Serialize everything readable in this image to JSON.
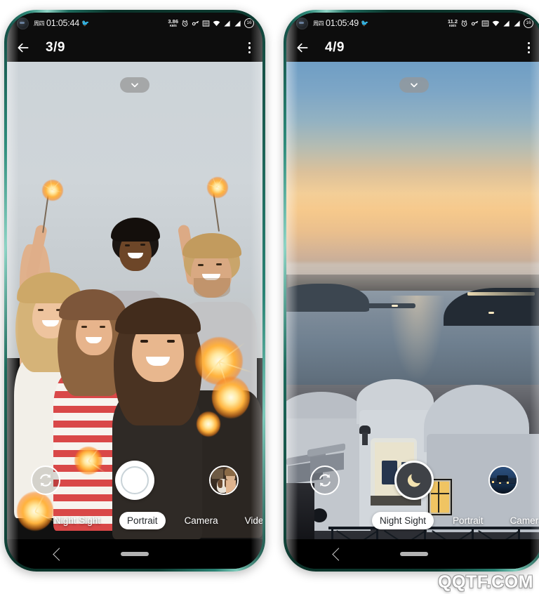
{
  "watermark": "QQTF.COM",
  "phones": [
    {
      "id": "phone-left",
      "status": {
        "day": "周四",
        "time": "01:05:44",
        "net_speed_value": "3.86",
        "net_speed_unit": "KB/S",
        "battery": "16",
        "icons": [
          "camera-punchhole",
          "bird-icon",
          "alarm-icon",
          "vpn-key-icon",
          "volte-icon",
          "wifi-icon",
          "signal-icon",
          "signal-icon",
          "battery-icon"
        ]
      },
      "appbar": {
        "back_icon": "arrow-back-icon",
        "page_count": "3/9",
        "menu_icon": "kebab-menu-icon"
      },
      "viewfinder": {
        "collapse_icon": "chevron-down-icon",
        "scene": "group-selfie-sparklers",
        "flip_icon": "camera-flip-icon",
        "shutter_icon": "shutter-button",
        "shutter_style": "normal",
        "thumbnail": "woman-with-dog-thumbnail"
      },
      "modes": [
        {
          "label": "Night Sight",
          "selected": false
        },
        {
          "label": "Portrait",
          "selected": true
        },
        {
          "label": "Camera",
          "selected": false
        },
        {
          "label": "Video",
          "selected": false
        }
      ],
      "navbar": {
        "back_icon": "nav-back-icon",
        "home_icon": "nav-home-indicator"
      }
    },
    {
      "id": "phone-right",
      "status": {
        "day": "周四",
        "time": "01:05:49",
        "net_speed_value": "11.2",
        "net_speed_unit": "KB/S",
        "battery": "16",
        "icons": [
          "camera-punchhole",
          "bird-icon",
          "alarm-icon",
          "vpn-key-icon",
          "volte-icon",
          "wifi-icon",
          "signal-icon",
          "signal-icon",
          "battery-icon"
        ]
      },
      "appbar": {
        "back_icon": "arrow-back-icon",
        "page_count": "4/9",
        "menu_icon": "kebab-menu-icon"
      },
      "viewfinder": {
        "collapse_icon": "chevron-down-icon",
        "scene": "santorini-sunset-seascape",
        "flip_icon": "camera-flip-icon",
        "shutter_icon": "moon-icon",
        "shutter_style": "night",
        "thumbnail": "night-cityscape-thumbnail"
      },
      "modes": [
        {
          "label": "Night Sight",
          "selected": true
        },
        {
          "label": "Portrait",
          "selected": false
        },
        {
          "label": "Camera",
          "selected": false
        }
      ],
      "navbar": {
        "back_icon": "nav-back-icon",
        "home_icon": "nav-home-indicator"
      }
    }
  ],
  "colors": {
    "frame": "#1d6a5c",
    "frame_highlight": "#8fd5c6",
    "statusbar_bg": "#0d0d0d",
    "accent_white": "#ffffff",
    "mode_selected_text": "#24282c",
    "night_shutter_bg": "#3f4247",
    "moon_color": "#f2e2b0"
  }
}
